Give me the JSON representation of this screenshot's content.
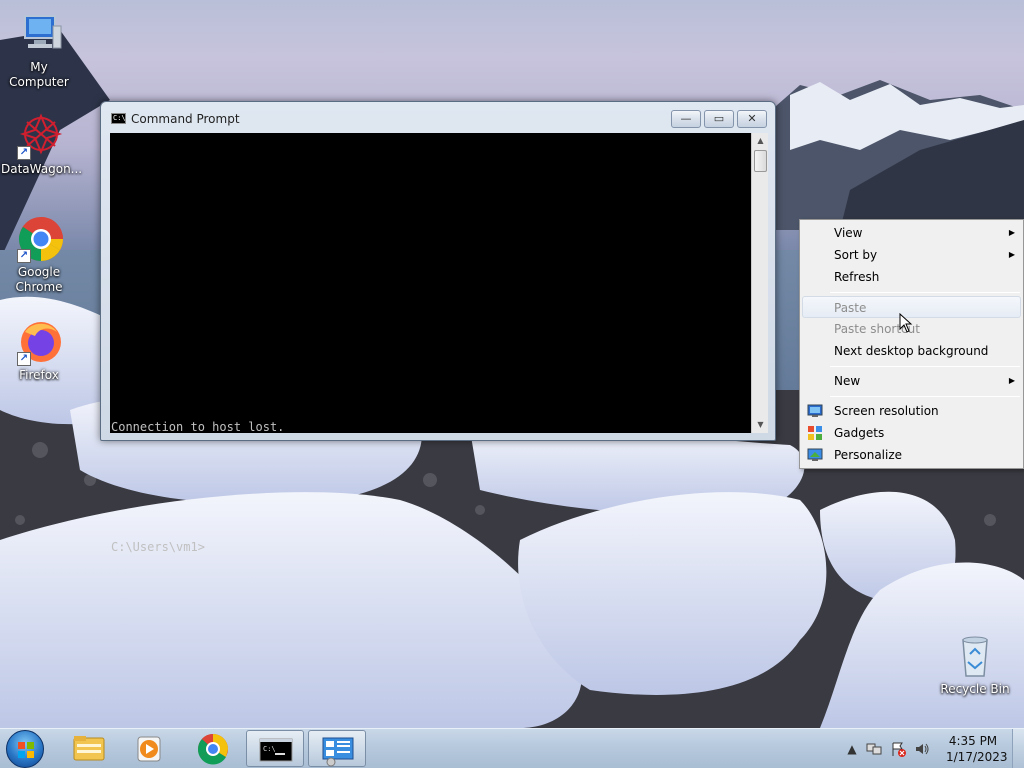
{
  "desktop_icons": [
    {
      "id": "my-computer",
      "label": "My Computer"
    },
    {
      "id": "datawagon",
      "label": "DataWagon..."
    },
    {
      "id": "google-chrome",
      "label": "Google Chrome"
    },
    {
      "id": "firefox",
      "label": "Firefox"
    },
    {
      "id": "recycle-bin",
      "label": "Recycle Bin"
    }
  ],
  "cmd_window": {
    "title": "Command Prompt",
    "lines": [
      "Connection to host lost.",
      "",
      "C:\\Users\\vm1>"
    ],
    "buttons": {
      "minimize": "—",
      "maximize": "▭",
      "close": "✕"
    }
  },
  "context_menu": {
    "items": [
      {
        "label": "View",
        "submenu": true,
        "disabled": false
      },
      {
        "label": "Sort by",
        "submenu": true,
        "disabled": false
      },
      {
        "label": "Refresh",
        "submenu": false,
        "disabled": false
      },
      {
        "label": "Paste",
        "submenu": false,
        "disabled": true
      },
      {
        "label": "Paste shortcut",
        "submenu": false,
        "disabled": true
      },
      {
        "label": "Next desktop background",
        "submenu": false,
        "disabled": false
      },
      {
        "label": "New",
        "submenu": true,
        "disabled": false
      },
      {
        "label": "Screen resolution",
        "submenu": false,
        "disabled": false,
        "icon": "monitor-icon"
      },
      {
        "label": "Gadgets",
        "submenu": false,
        "disabled": false,
        "icon": "gadgets-icon"
      },
      {
        "label": "Personalize",
        "submenu": false,
        "disabled": false,
        "icon": "personalize-icon"
      }
    ]
  },
  "taskbar": {
    "pinned": [
      "file-explorer-icon",
      "media-player-icon",
      "chrome-icon",
      "command-prompt-icon",
      "control-panel-icon"
    ],
    "clock": {
      "time": "4:35 PM",
      "date": "1/17/2023"
    }
  },
  "colors": {
    "accent": "#2a77c7",
    "console_bg": "#000000",
    "console_fg": "#c0c0c0"
  }
}
